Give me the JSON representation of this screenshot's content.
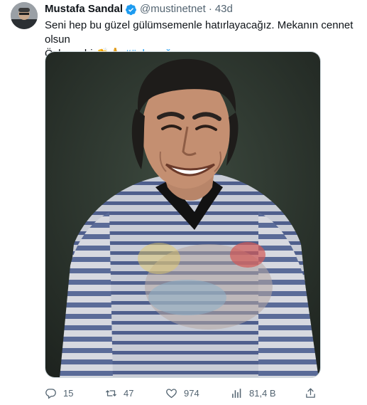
{
  "tweet": {
    "display_name": "Mustafa Sandal",
    "handle": "@mustinetnet",
    "separator": "·",
    "time": "43d",
    "text_line1": "Seni hep bu güzel gülümsemenle hatırlayacağız. Mekanın cennet olsun",
    "text_line2_prefix": "Özkan abi",
    "emoji_hands": "👏",
    "emoji_pray": "🙏",
    "hashtag": "#özkanuğur"
  },
  "actions": {
    "replies": "15",
    "retweets": "47",
    "likes": "974",
    "views": "81,4 B"
  },
  "icons": {
    "verified": "verified-badge-icon",
    "reply": "reply-icon",
    "retweet": "retweet-icon",
    "like": "heart-icon",
    "views": "views-chart-icon",
    "share": "share-icon"
  },
  "colors": {
    "text": "#0f1419",
    "secondary": "#536471",
    "accent": "#1d9bf0"
  }
}
